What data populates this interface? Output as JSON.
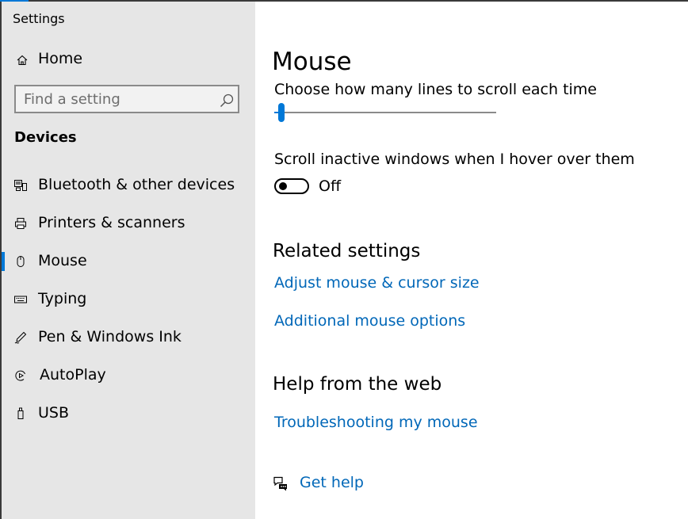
{
  "window": {
    "title": "Settings",
    "accent_color": "#0078d7",
    "link_color": "#0067b8"
  },
  "sidebar": {
    "home": {
      "label": "Home",
      "icon": "home-icon"
    },
    "search": {
      "placeholder": "Find a setting",
      "value": "",
      "icon": "search-icon"
    },
    "section_heading": "Devices",
    "items": [
      {
        "label": "Bluetooth & other devices",
        "icon": "bluetooth-devices-icon",
        "selected": false
      },
      {
        "label": "Printers & scanners",
        "icon": "printer-icon",
        "selected": false
      },
      {
        "label": "Mouse",
        "icon": "mouse-icon",
        "selected": true
      },
      {
        "label": "Typing",
        "icon": "keyboard-icon",
        "selected": false
      },
      {
        "label": "Pen & Windows Ink",
        "icon": "pen-icon",
        "selected": false
      },
      {
        "label": "AutoPlay",
        "icon": "autoplay-icon",
        "selected": false
      },
      {
        "label": "USB",
        "icon": "usb-icon",
        "selected": false
      }
    ]
  },
  "main": {
    "page_title": "Mouse",
    "scroll_lines": {
      "label": "Choose how many lines to scroll each time",
      "slider_fraction": 0.02
    },
    "scroll_inactive": {
      "label": "Scroll inactive windows when I hover over them",
      "state": "Off"
    },
    "related": {
      "heading": "Related settings",
      "links": [
        "Adjust mouse & cursor size",
        "Additional mouse options"
      ]
    },
    "help_web": {
      "heading": "Help from the web",
      "links": [
        "Troubleshooting my mouse"
      ]
    },
    "get_help": {
      "label": "Get help",
      "icon": "get-help-icon"
    }
  }
}
